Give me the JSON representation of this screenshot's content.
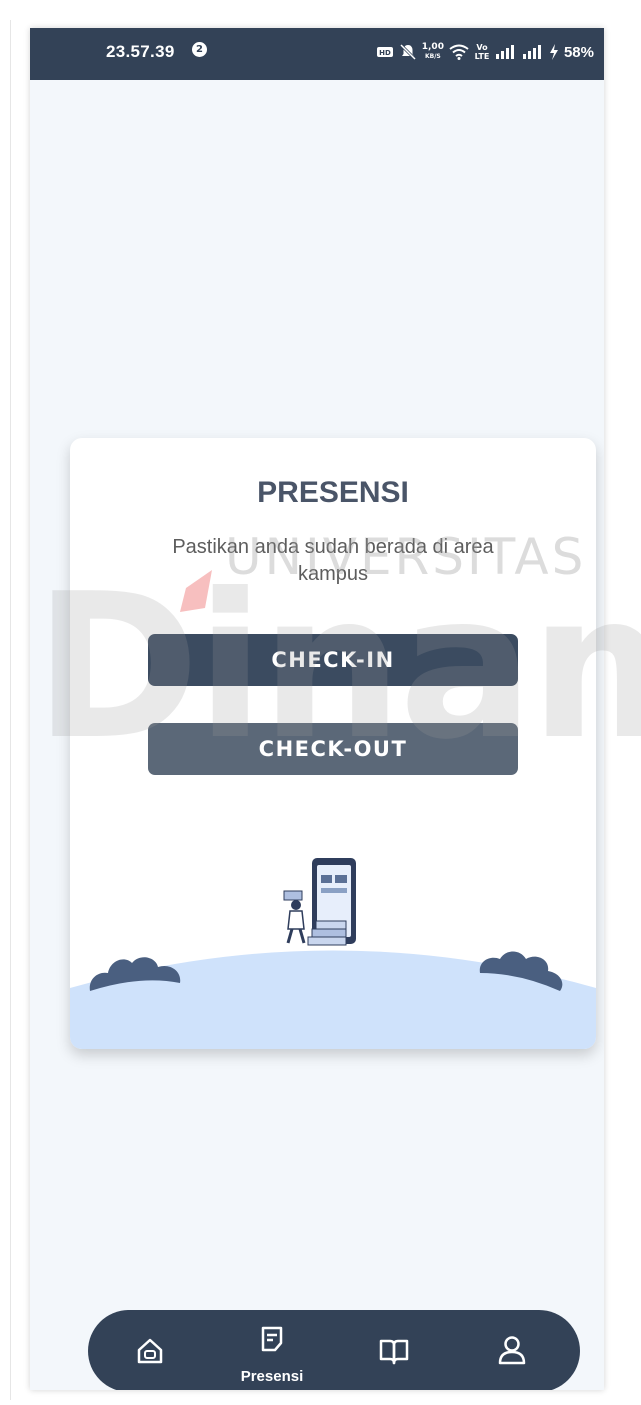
{
  "status_bar": {
    "time": "23.57.39",
    "notification_count": "2",
    "network_speed": "1,00",
    "network_speed_unit": "KB/S",
    "lte_label": "Vo LTE",
    "battery": "58%"
  },
  "card": {
    "title": "PRESENSI",
    "subtitle": "Pastikan anda sudah berada di area kampus",
    "checkin_label": "CHECK-IN",
    "checkout_label": "CHECK-OUT"
  },
  "bottom_nav": {
    "items": [
      {
        "icon": "home-icon",
        "label": ""
      },
      {
        "icon": "presensi-icon",
        "label": "Presensi"
      },
      {
        "icon": "book-icon",
        "label": ""
      },
      {
        "icon": "profile-icon",
        "label": ""
      }
    ]
  },
  "watermark": {
    "line1": "UNIVERSITAS",
    "line2": "Dinamika"
  },
  "colors": {
    "primary": "#334257",
    "checkin": "#3b4b60",
    "checkout": "#5b6878",
    "background": "#f3f7fb",
    "hill": "#cfe2fb",
    "watermark_accent": "#f08a8a"
  }
}
